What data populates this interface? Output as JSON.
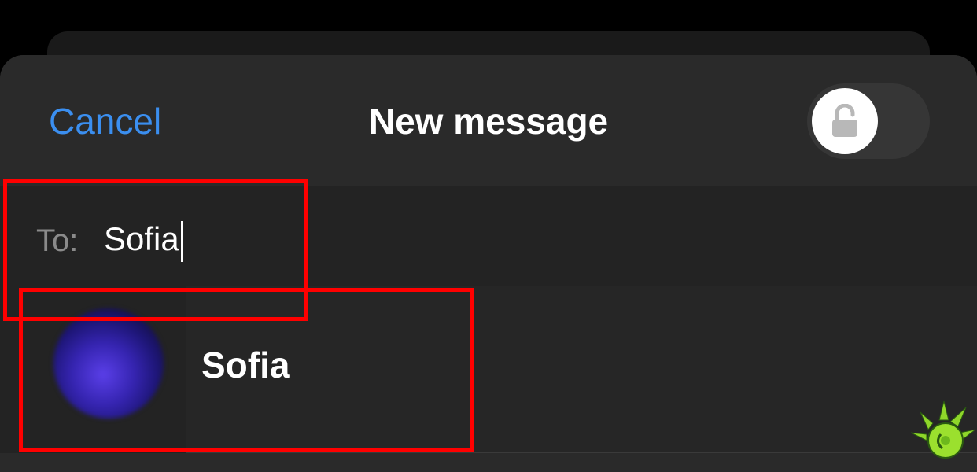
{
  "header": {
    "cancel_label": "Cancel",
    "title": "New message",
    "lock_toggle": {
      "icon": "lock-open-icon",
      "state": "off"
    }
  },
  "to_field": {
    "label": "To:",
    "value": "Sofia"
  },
  "suggestions": [
    {
      "name": "Sofia",
      "avatar": "avatar-photo"
    }
  ],
  "colors": {
    "accent": "#3b8ff0",
    "highlight": "#ff0000",
    "background": "#2a2a2a"
  }
}
